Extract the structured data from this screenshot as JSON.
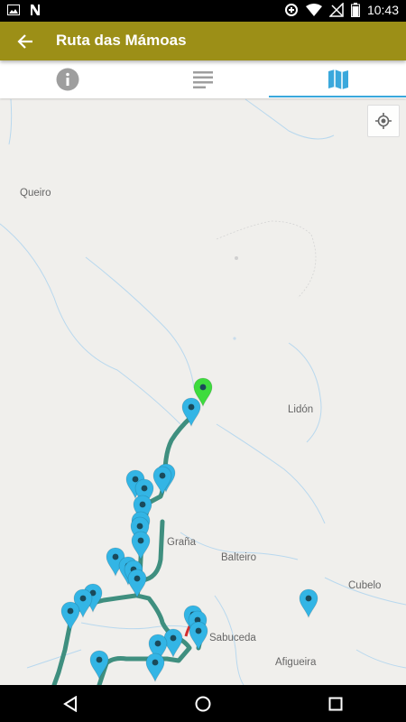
{
  "status_bar": {
    "time": "10:43",
    "left_icons": [
      "image-notification-icon",
      "n-notification-icon"
    ],
    "right_icons": [
      "data-saver-icon",
      "wifi-icon",
      "no-signal-icon",
      "battery-icon"
    ]
  },
  "app_bar": {
    "title": "Ruta das Mámoas",
    "back_icon": "arrow-back-icon",
    "color": "#9c8f17"
  },
  "tabs": [
    {
      "icon": "info-icon",
      "selected": false
    },
    {
      "icon": "list-icon",
      "selected": false
    },
    {
      "icon": "map-icon",
      "selected": true
    }
  ],
  "accent_color": "#3aa8dc",
  "map": {
    "places": [
      {
        "name": "Queiro"
      },
      {
        "name": "Lidón"
      },
      {
        "name": "Graña"
      },
      {
        "name": "Balteiro"
      },
      {
        "name": "Cubelo"
      },
      {
        "name": "Sabuceda"
      },
      {
        "name": "Afigueira"
      }
    ],
    "locate_button_icon": "my-location-icon",
    "route_color": "#3f8f7f",
    "marker_color": "#33b5e5",
    "start_marker_color": "#3ddc3d",
    "alt_route_color": "#d32f2f"
  },
  "nav_bar": {
    "buttons": [
      "back-triangle-icon",
      "home-circle-icon",
      "recents-square-icon"
    ]
  }
}
